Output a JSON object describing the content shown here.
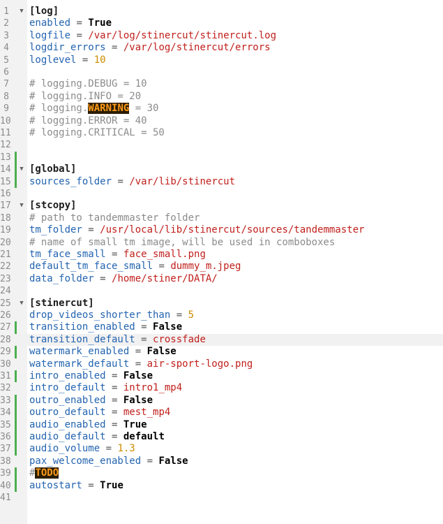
{
  "editor": {
    "current_line": 28,
    "lines": [
      {
        "n": "1",
        "fold": true,
        "parts": [
          {
            "t": "sec",
            "v": "[log]"
          }
        ]
      },
      {
        "n": "2",
        "parts": [
          {
            "t": "key",
            "v": "enabled"
          },
          {
            "t": "op",
            "v": " = "
          },
          {
            "t": "kw",
            "v": "True"
          }
        ]
      },
      {
        "n": "3",
        "parts": [
          {
            "t": "key",
            "v": "logfile"
          },
          {
            "t": "op",
            "v": " = "
          },
          {
            "t": "str",
            "v": "/var/log/stinercut/stinercut.log"
          }
        ]
      },
      {
        "n": "4",
        "parts": [
          {
            "t": "key",
            "v": "logdir_errors"
          },
          {
            "t": "op",
            "v": " = "
          },
          {
            "t": "str",
            "v": "/var/log/stinercut/errors"
          }
        ]
      },
      {
        "n": "5",
        "parts": [
          {
            "t": "key",
            "v": "loglevel"
          },
          {
            "t": "op",
            "v": " = "
          },
          {
            "t": "num",
            "v": "10"
          }
        ]
      },
      {
        "n": "6",
        "parts": []
      },
      {
        "n": "7",
        "parts": [
          {
            "t": "cmt",
            "v": "# logging.DEBUG = 10"
          }
        ]
      },
      {
        "n": "8",
        "parts": [
          {
            "t": "cmt",
            "v": "# logging.INFO = 20"
          }
        ]
      },
      {
        "n": "9",
        "parts": [
          {
            "t": "cmt",
            "v": "# logging."
          },
          {
            "t": "hl",
            "v": "WARNING"
          },
          {
            "t": "cmt",
            "v": " = 30"
          }
        ]
      },
      {
        "n": "10",
        "parts": [
          {
            "t": "cmt",
            "v": "# logging.ERROR = 40"
          }
        ]
      },
      {
        "n": "11",
        "parts": [
          {
            "t": "cmt",
            "v": "# logging.CRITICAL = 50"
          }
        ]
      },
      {
        "n": "12",
        "parts": []
      },
      {
        "n": "13",
        "mark": true,
        "parts": []
      },
      {
        "n": "14",
        "fold": true,
        "mark": true,
        "parts": [
          {
            "t": "sec",
            "v": "[global]"
          }
        ]
      },
      {
        "n": "15",
        "mark": true,
        "parts": [
          {
            "t": "key",
            "v": "sources_folder"
          },
          {
            "t": "op",
            "v": " = "
          },
          {
            "t": "str",
            "v": "/var/lib/stinercut"
          }
        ]
      },
      {
        "n": "16",
        "parts": []
      },
      {
        "n": "17",
        "fold": true,
        "parts": [
          {
            "t": "sec",
            "v": "[stcopy]"
          }
        ]
      },
      {
        "n": "18",
        "parts": [
          {
            "t": "cmt",
            "v": "# path to tandemmaster folder"
          }
        ]
      },
      {
        "n": "19",
        "parts": [
          {
            "t": "key",
            "v": "tm_folder"
          },
          {
            "t": "op",
            "v": " = "
          },
          {
            "t": "str",
            "v": "/usr/local/lib/stinercut/sources/tandemmaster"
          }
        ]
      },
      {
        "n": "20",
        "parts": [
          {
            "t": "cmt",
            "v": "# name of small tm image, will be used in comboboxes"
          }
        ]
      },
      {
        "n": "21",
        "parts": [
          {
            "t": "key",
            "v": "tm_face_small"
          },
          {
            "t": "op",
            "v": " = "
          },
          {
            "t": "str",
            "v": "face_small.png"
          }
        ]
      },
      {
        "n": "22",
        "parts": [
          {
            "t": "key",
            "v": "default_tm_face_small"
          },
          {
            "t": "op",
            "v": " = "
          },
          {
            "t": "str",
            "v": "dummy_m.jpeg"
          }
        ]
      },
      {
        "n": "23",
        "parts": [
          {
            "t": "key",
            "v": "data_folder"
          },
          {
            "t": "op",
            "v": " = "
          },
          {
            "t": "str",
            "v": "/home/stiner/DATA/"
          }
        ]
      },
      {
        "n": "24",
        "parts": []
      },
      {
        "n": "25",
        "fold": true,
        "parts": [
          {
            "t": "sec",
            "v": "[stinercut]"
          }
        ]
      },
      {
        "n": "26",
        "parts": [
          {
            "t": "key",
            "v": "drop_videos_shorter_than"
          },
          {
            "t": "op",
            "v": " = "
          },
          {
            "t": "num",
            "v": "5"
          }
        ]
      },
      {
        "n": "27",
        "mark": true,
        "parts": [
          {
            "t": "key",
            "v": "transition_enabled"
          },
          {
            "t": "op",
            "v": " = "
          },
          {
            "t": "kw",
            "v": "False"
          }
        ]
      },
      {
        "n": "28",
        "parts": [
          {
            "t": "key",
            "v": "transition_default"
          },
          {
            "t": "op",
            "v": " = "
          },
          {
            "t": "str",
            "v": "crossfade"
          }
        ]
      },
      {
        "n": "29",
        "mark": true,
        "parts": [
          {
            "t": "key",
            "v": "watermark_enabled"
          },
          {
            "t": "op",
            "v": " = "
          },
          {
            "t": "kw",
            "v": "False"
          }
        ]
      },
      {
        "n": "30",
        "parts": [
          {
            "t": "key",
            "v": "watermark_default"
          },
          {
            "t": "op",
            "v": " = "
          },
          {
            "t": "str",
            "v": "air-sport-logo.png"
          }
        ]
      },
      {
        "n": "31",
        "mark": true,
        "parts": [
          {
            "t": "key",
            "v": "intro_enabled"
          },
          {
            "t": "op",
            "v": " = "
          },
          {
            "t": "kw",
            "v": "False"
          }
        ]
      },
      {
        "n": "32",
        "parts": [
          {
            "t": "key",
            "v": "intro_default"
          },
          {
            "t": "op",
            "v": " = "
          },
          {
            "t": "str",
            "v": "intro1_mp4"
          }
        ]
      },
      {
        "n": "33",
        "mark": true,
        "parts": [
          {
            "t": "key",
            "v": "outro_enabled"
          },
          {
            "t": "op",
            "v": " = "
          },
          {
            "t": "kw",
            "v": "False"
          }
        ]
      },
      {
        "n": "34",
        "mark": true,
        "parts": [
          {
            "t": "key",
            "v": "outro_default"
          },
          {
            "t": "op",
            "v": " = "
          },
          {
            "t": "str",
            "v": "mest_mp4"
          }
        ]
      },
      {
        "n": "35",
        "mark": true,
        "parts": [
          {
            "t": "key",
            "v": "audio_enabled"
          },
          {
            "t": "op",
            "v": " = "
          },
          {
            "t": "kw",
            "v": "True"
          }
        ]
      },
      {
        "n": "36",
        "mark": true,
        "parts": [
          {
            "t": "key",
            "v": "audio_default"
          },
          {
            "t": "op",
            "v": " = "
          },
          {
            "t": "kw",
            "v": "default"
          }
        ]
      },
      {
        "n": "37",
        "mark": true,
        "parts": [
          {
            "t": "key",
            "v": "audio_volume"
          },
          {
            "t": "op",
            "v": " = "
          },
          {
            "t": "num",
            "v": "1.3"
          }
        ]
      },
      {
        "n": "38",
        "parts": [
          {
            "t": "key",
            "v": "pax_welcome_enabled"
          },
          {
            "t": "op",
            "v": " = "
          },
          {
            "t": "kw",
            "v": "False"
          }
        ]
      },
      {
        "n": "39",
        "mark": true,
        "parts": [
          {
            "t": "cmt",
            "v": "#"
          },
          {
            "t": "hl",
            "v": "TODO"
          }
        ]
      },
      {
        "n": "40",
        "mark": true,
        "parts": [
          {
            "t": "key",
            "v": "autostart"
          },
          {
            "t": "op",
            "v": " = "
          },
          {
            "t": "kw",
            "v": "True"
          }
        ]
      },
      {
        "n": "41",
        "parts": []
      }
    ]
  }
}
